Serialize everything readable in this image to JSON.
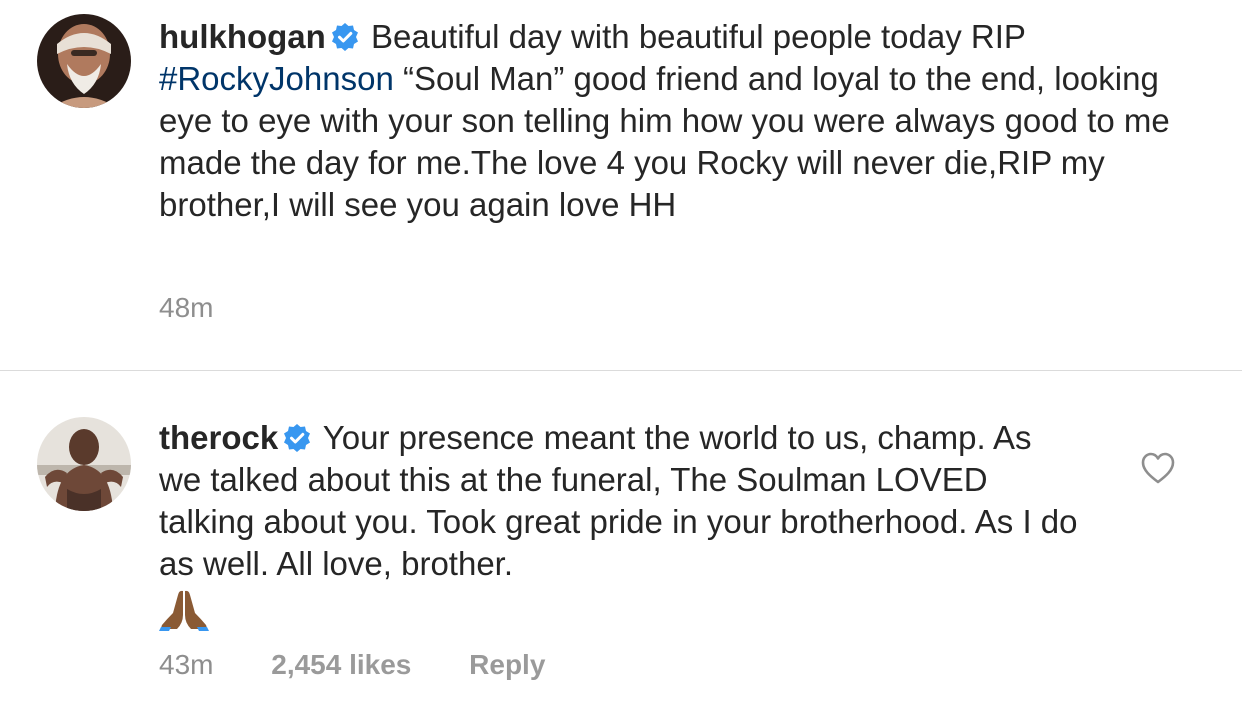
{
  "comments": [
    {
      "username": "hulkhogan",
      "verified": true,
      "text_before_hashtag": "Beautiful day with beautiful people today RIP",
      "hashtag": "#RockyJohnson",
      "text_after_hashtag": "“Soul Man” good friend and loyal to the end, looking eye to eye with your son telling him how you were always good to me made the day for me.The love 4 you Rocky will never die,RIP my brother,I will see you again love HH",
      "time": "48m",
      "avatar_icon": "hulkhogan-avatar"
    },
    {
      "username": "therock",
      "verified": true,
      "text": "Your presence meant the world to us, champ. As we talked about this at the funeral, The Soulman LOVED talking about you. Took great pride in your brotherhood. As I do as well. All love, brother.",
      "emoji_icon": "folded-hands-icon",
      "time": "43m",
      "likes": "2,454 likes",
      "reply": "Reply",
      "avatar_icon": "therock-avatar"
    }
  ],
  "colors": {
    "verified_badge": "#3897f0",
    "hashtag": "#003569",
    "meta_text": "#8e8e8e",
    "divider": "#dbdbdb"
  }
}
